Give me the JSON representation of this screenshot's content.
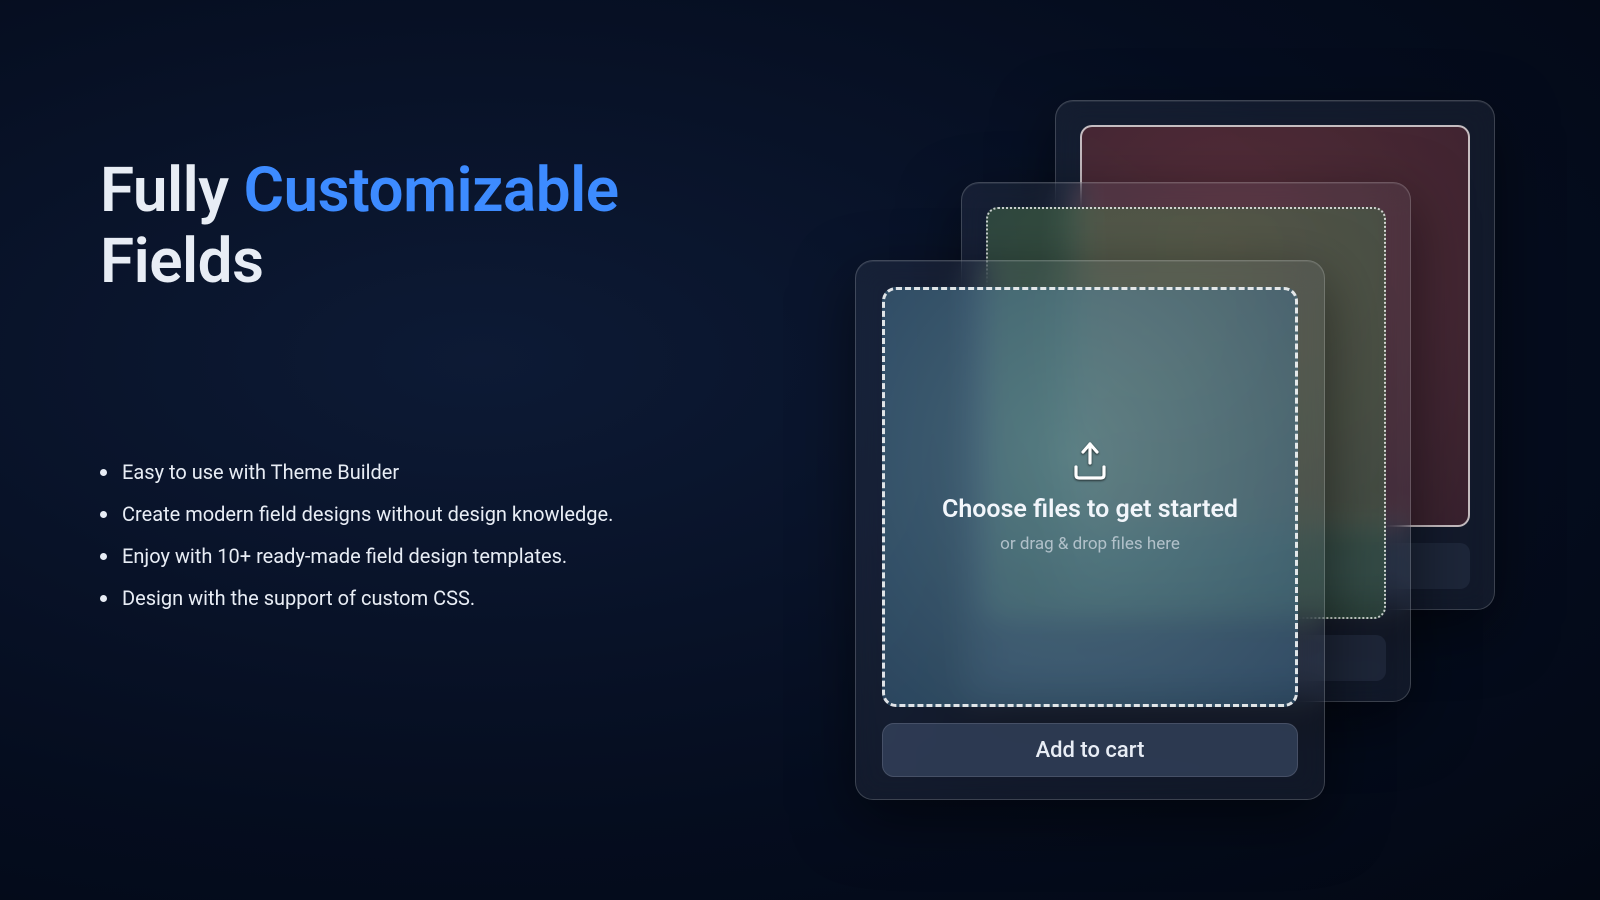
{
  "headline": {
    "part1": "Fully ",
    "accent": "Customizable",
    "part2": "Fields"
  },
  "features": [
    "Easy to use with Theme Builder",
    "Create modern field designs without design knowledge.",
    "Enjoy with 10+ ready-made field design templates.",
    "Design with the support of custom CSS."
  ],
  "upload": {
    "title": "Choose files to get started",
    "subtitle": "or drag & drop files here",
    "button": "Add to cart"
  }
}
